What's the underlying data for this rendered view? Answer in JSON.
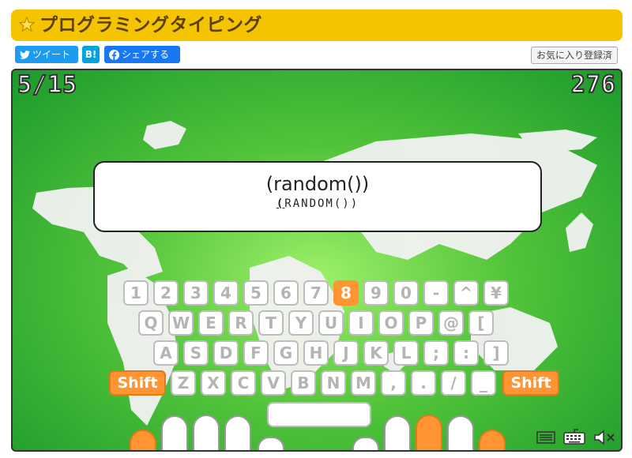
{
  "header": {
    "title": "プログラミングタイピング",
    "star_icon": "star-icon"
  },
  "social": {
    "tweet_label": "ツイート",
    "hatena_label": "B!",
    "share_label": "シェアする",
    "favorite_label": "お気に入り登録済"
  },
  "game": {
    "progress": "5/15",
    "score": "276",
    "prompt": {
      "word": "(random())",
      "kana_current": "(",
      "kana_rest": "RANDOM())"
    },
    "keyboard": {
      "row1": [
        "1",
        "2",
        "3",
        "4",
        "5",
        "6",
        "7",
        "8",
        "9",
        "0",
        "-",
        "^",
        "¥"
      ],
      "row2": [
        "Q",
        "W",
        "E",
        "R",
        "T",
        "Y",
        "U",
        "I",
        "O",
        "P",
        "@",
        "["
      ],
      "row3": [
        "A",
        "S",
        "D",
        "F",
        "G",
        "H",
        "J",
        "K",
        "L",
        ";",
        ":",
        "]"
      ],
      "row4": [
        "Shift",
        "Z",
        "X",
        "C",
        "V",
        "B",
        "N",
        "M",
        ",",
        ".",
        "/",
        "_",
        "Shift"
      ],
      "highlighted_key": "8"
    },
    "controls": [
      "menu-icon",
      "keyboard-icon",
      "mute-icon"
    ],
    "colors": {
      "highlight": "#ff9433",
      "title_bar": "#f5c400"
    }
  }
}
